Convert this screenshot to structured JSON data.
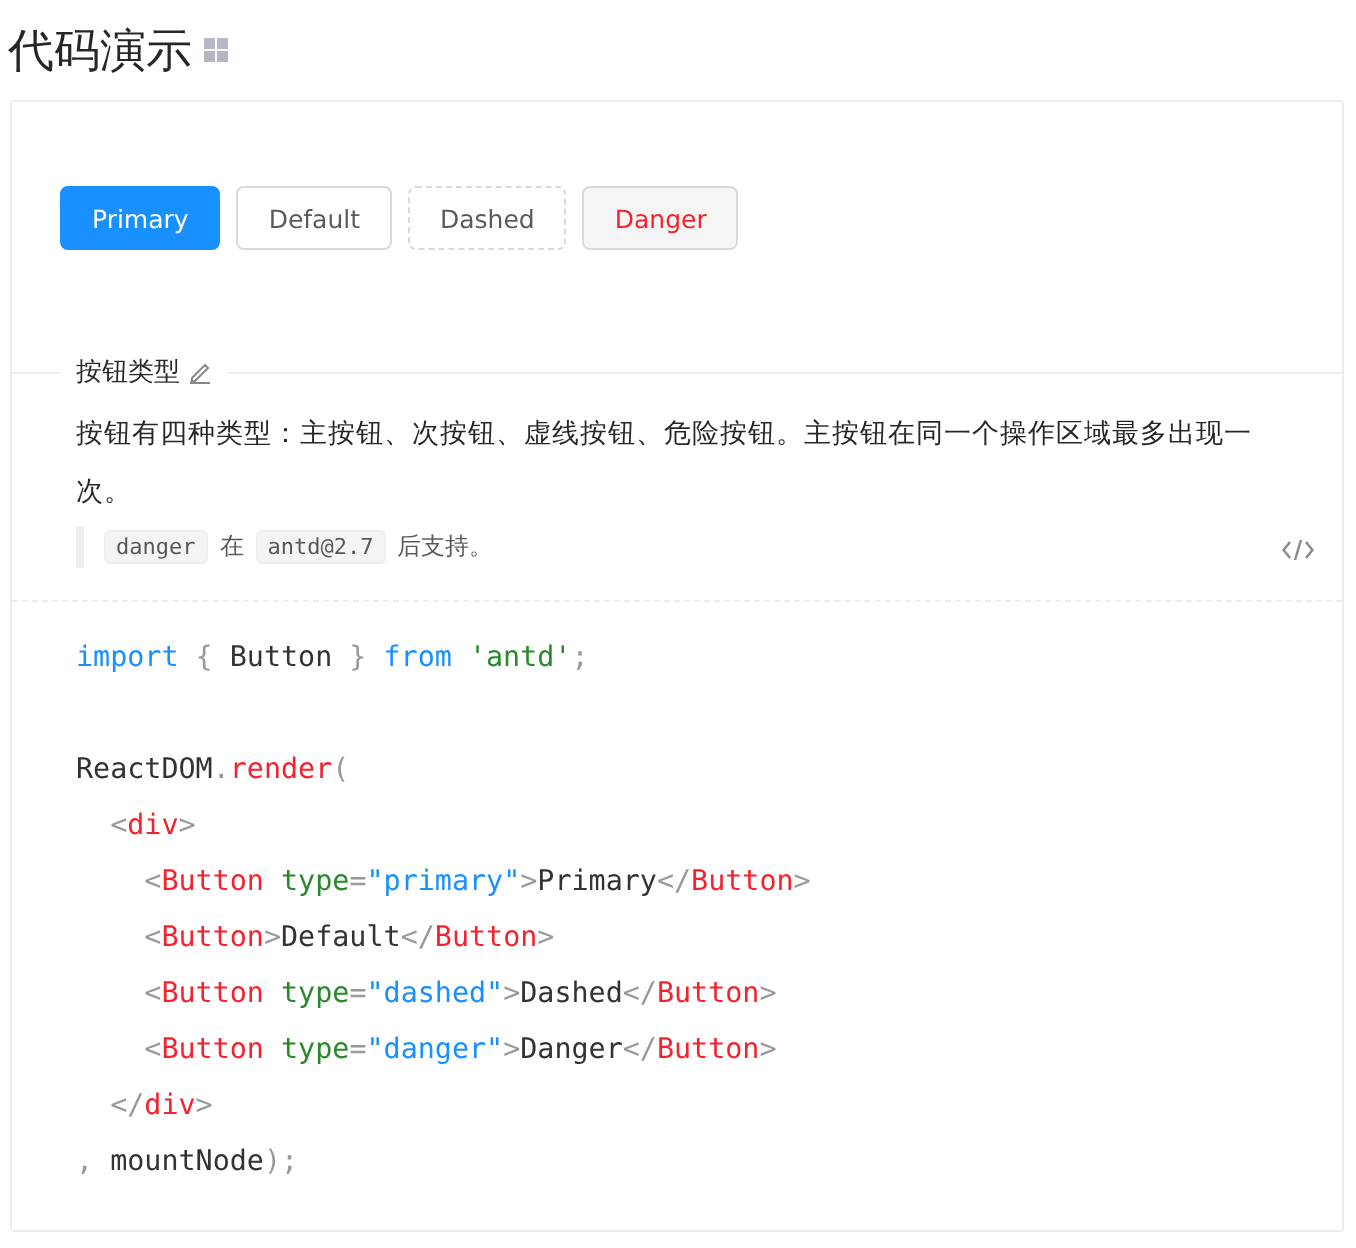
{
  "title": "代码演示",
  "buttons": [
    {
      "label": "Primary",
      "kind": "primary"
    },
    {
      "label": "Default",
      "kind": "default"
    },
    {
      "label": "Dashed",
      "kind": "dashed"
    },
    {
      "label": "Danger",
      "kind": "danger"
    }
  ],
  "demo_title": "按钮类型",
  "description": "按钮有四种类型：主按钮、次按钮、虚线按钮、危险按钮。主按钮在同一个操作区域最多出现一次。",
  "note": [
    {
      "kind": "code",
      "text": "danger"
    },
    {
      "kind": "text",
      "text": "在"
    },
    {
      "kind": "code",
      "text": "antd@2.7"
    },
    {
      "kind": "text",
      "text": "后支持。"
    }
  ],
  "code_lines": [
    {
      "tokens": [
        {
          "kind": "keyword",
          "text": "import"
        },
        {
          "kind": "punct",
          "text": " { "
        },
        {
          "kind": "plain",
          "text": "Button"
        },
        {
          "kind": "punct",
          "text": " } "
        },
        {
          "kind": "keyword",
          "text": "from"
        },
        {
          "kind": "string",
          "text": " 'antd'"
        },
        {
          "kind": "punct",
          "text": ";"
        }
      ]
    },
    {
      "gap_before": true,
      "tokens": [
        {
          "kind": "plain",
          "text": "ReactDOM"
        },
        {
          "kind": "punct",
          "text": "."
        },
        {
          "kind": "tag",
          "text": "render"
        },
        {
          "kind": "punct",
          "text": "("
        }
      ]
    },
    {
      "tokens": [
        {
          "kind": "punct",
          "text": "  <"
        },
        {
          "kind": "tag",
          "text": "div"
        },
        {
          "kind": "punct",
          "text": ">"
        }
      ]
    },
    {
      "tokens": [
        {
          "kind": "punct",
          "text": "    <"
        },
        {
          "kind": "tag",
          "text": "Button"
        },
        {
          "kind": "attr",
          "text": " type"
        },
        {
          "kind": "punct",
          "text": "="
        },
        {
          "kind": "value",
          "text": "\"primary\""
        },
        {
          "kind": "punct",
          "text": ">"
        },
        {
          "kind": "plain",
          "text": "Primary"
        },
        {
          "kind": "punct",
          "text": "</"
        },
        {
          "kind": "tag",
          "text": "Button"
        },
        {
          "kind": "punct",
          "text": ">"
        }
      ]
    },
    {
      "tokens": [
        {
          "kind": "punct",
          "text": "    <"
        },
        {
          "kind": "tag",
          "text": "Button"
        },
        {
          "kind": "punct",
          "text": ">"
        },
        {
          "kind": "plain",
          "text": "Default"
        },
        {
          "kind": "punct",
          "text": "</"
        },
        {
          "kind": "tag",
          "text": "Button"
        },
        {
          "kind": "punct",
          "text": ">"
        }
      ]
    },
    {
      "tokens": [
        {
          "kind": "punct",
          "text": "    <"
        },
        {
          "kind": "tag",
          "text": "Button"
        },
        {
          "kind": "attr",
          "text": " type"
        },
        {
          "kind": "punct",
          "text": "="
        },
        {
          "kind": "value",
          "text": "\"dashed\""
        },
        {
          "kind": "punct",
          "text": ">"
        },
        {
          "kind": "plain",
          "text": "Dashed"
        },
        {
          "kind": "punct",
          "text": "</"
        },
        {
          "kind": "tag",
          "text": "Button"
        },
        {
          "kind": "punct",
          "text": ">"
        }
      ]
    },
    {
      "tokens": [
        {
          "kind": "punct",
          "text": "    <"
        },
        {
          "kind": "tag",
          "text": "Button"
        },
        {
          "kind": "attr",
          "text": " type"
        },
        {
          "kind": "punct",
          "text": "="
        },
        {
          "kind": "value",
          "text": "\"danger\""
        },
        {
          "kind": "punct",
          "text": ">"
        },
        {
          "kind": "plain",
          "text": "Danger"
        },
        {
          "kind": "punct",
          "text": "</"
        },
        {
          "kind": "tag",
          "text": "Button"
        },
        {
          "kind": "punct",
          "text": ">"
        }
      ]
    },
    {
      "tokens": [
        {
          "kind": "punct",
          "text": "  </"
        },
        {
          "kind": "tag",
          "text": "div"
        },
        {
          "kind": "punct",
          "text": ">"
        }
      ]
    },
    {
      "tokens": [
        {
          "kind": "punct",
          "text": ", "
        },
        {
          "kind": "plain",
          "text": "mountNode"
        },
        {
          "kind": "punct",
          "text": ");"
        }
      ]
    }
  ]
}
